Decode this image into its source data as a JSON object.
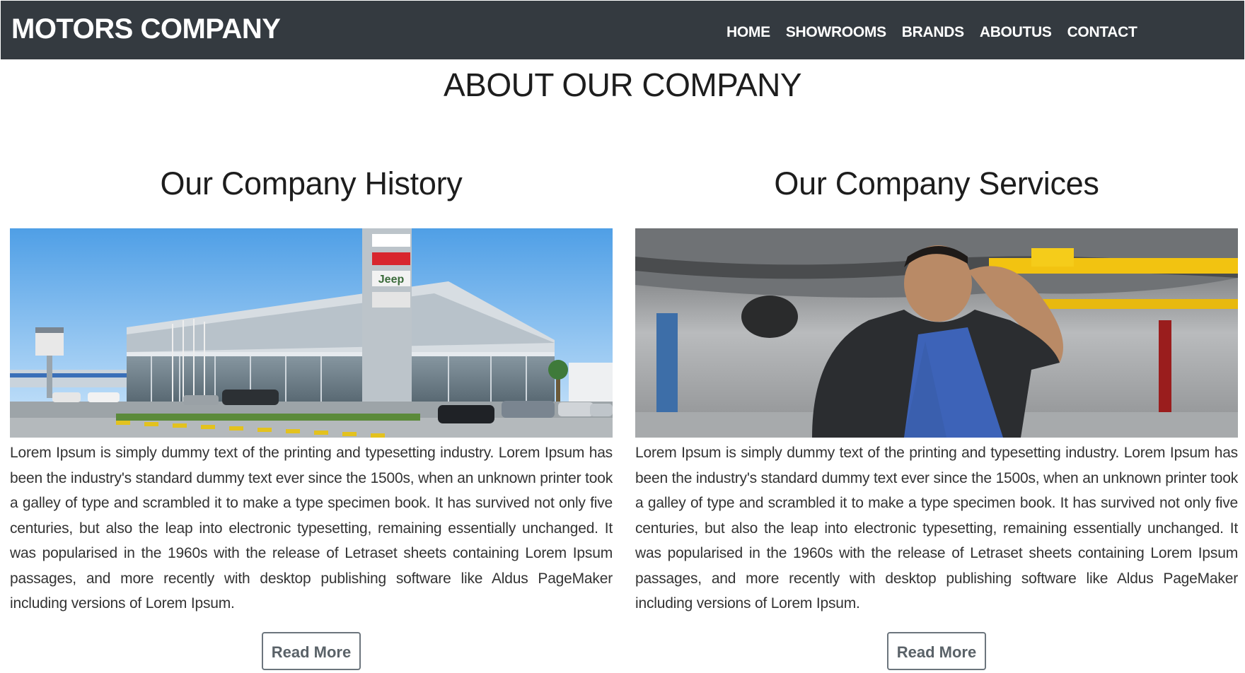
{
  "header": {
    "brand": "MOTORS COMPANY",
    "nav": [
      "HOME",
      "SHOWROOMS",
      "BRANDS",
      "ABOUTUS",
      "CONTACT"
    ]
  },
  "main": {
    "title": "ABOUT OUR COMPANY",
    "sections": [
      {
        "title": "Our Company History",
        "image": "showroom-building-photo",
        "text": "Lorem Ipsum is simply dummy text of the printing and typesetting industry. Lorem Ipsum has been the industry's standard dummy text ever since the 1500s, when an unknown printer took a galley of type and scrambled it to make a type specimen book. It has survived not only five centuries, but also the leap into electronic typesetting, remaining essentially unchanged. It was popularised in the 1960s with the release of Letraset sheets containing Lorem Ipsum passages, and more recently with desktop publishing software like Aldus PageMaker including versions of Lorem Ipsum.",
        "button": "Read More"
      },
      {
        "title": "Our Company Services",
        "image": "mechanic-under-car-photo",
        "text": "Lorem Ipsum is simply dummy text of the printing and typesetting industry. Lorem Ipsum has been the industry's standard dummy text ever since the 1500s, when an unknown printer took a galley of type and scrambled it to make a type specimen book. It has survived not only five centuries, but also the leap into electronic typesetting, remaining essentially unchanged. It was popularised in the 1960s with the release of Letraset sheets containing Lorem Ipsum passages, and more recently with desktop publishing software like Aldus PageMaker including versions of Lorem Ipsum.",
        "button": "Read More"
      }
    ]
  },
  "showroom_sign_text": "Jeep"
}
